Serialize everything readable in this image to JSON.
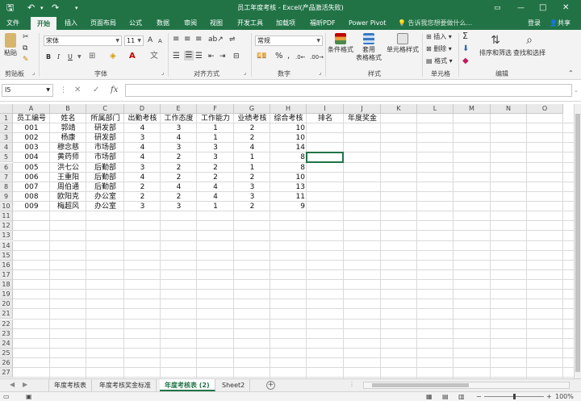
{
  "titlebar": {
    "title": "员工年度考核 - Excel(产品激活失败)",
    "save_icon": "🖫",
    "undo_icon": "↶",
    "redo_icon": "↷",
    "more_icon": "▾",
    "restore_icon": "▭",
    "minimize_icon": "—",
    "maximize_icon": "□",
    "close_icon": "✕"
  },
  "tabs": [
    "文件",
    "开始",
    "插入",
    "页面布局",
    "公式",
    "数据",
    "审阅",
    "视图",
    "开发工具",
    "加载项",
    "福昕PDF",
    "Power Pivot"
  ],
  "active_tab": "开始",
  "tellme": "告诉我您想要做什么...",
  "login": "登录",
  "share": "共享",
  "ribbon": {
    "clipboard": {
      "paste": "粘贴",
      "label": "剪贴板"
    },
    "font": {
      "name": "宋体",
      "size": "11",
      "bold": "B",
      "italic": "I",
      "underline": "U",
      "grow": "A",
      "shrink": "A",
      "label": "字体"
    },
    "alignment": {
      "label": "对齐方式"
    },
    "number": {
      "format": "常规",
      "percent": "%",
      "comma": ",",
      "label": "数字"
    },
    "styles": {
      "conditional": "条件格式",
      "table": "套用\n表格格式",
      "cell": "单元格样式",
      "label": "样式"
    },
    "cells": {
      "insert": "插入",
      "delete": "删除",
      "format": "格式",
      "label": "单元格"
    },
    "editing": {
      "sum": "Σ",
      "sort": "排序和筛选",
      "find": "查找和选择",
      "label": "编辑"
    }
  },
  "formula_bar": {
    "namebox": "I5",
    "cancel": "✕",
    "enter": "✓",
    "fx": "fx",
    "value": ""
  },
  "columns": [
    "A",
    "B",
    "C",
    "D",
    "E",
    "F",
    "G",
    "H",
    "I",
    "J",
    "K",
    "L",
    "M",
    "N",
    "O"
  ],
  "rows": [
    "1",
    "2",
    "3",
    "4",
    "5",
    "6",
    "7",
    "8",
    "9",
    "10",
    "11",
    "12",
    "13",
    "14",
    "15",
    "16",
    "17",
    "18",
    "19",
    "20",
    "21",
    "22",
    "23",
    "24",
    "25",
    "26",
    "27"
  ],
  "table": {
    "headers": [
      "员工编号",
      "姓名",
      "所属部门",
      "出勤考核",
      "工作态度",
      "工作能力",
      "业绩考核",
      "综合考核",
      "排名",
      "年度奖金"
    ],
    "rows": [
      [
        "001",
        "郭靖",
        "研发部",
        "4",
        "3",
        "1",
        "2",
        "10"
      ],
      [
        "002",
        "杨康",
        "研发部",
        "3",
        "4",
        "1",
        "2",
        "10"
      ],
      [
        "003",
        "穆念慈",
        "市场部",
        "4",
        "3",
        "3",
        "4",
        "14"
      ],
      [
        "004",
        "黄药师",
        "市场部",
        "4",
        "2",
        "3",
        "1",
        "8"
      ],
      [
        "005",
        "洪七公",
        "后勤部",
        "3",
        "2",
        "2",
        "1",
        "8"
      ],
      [
        "006",
        "王重阳",
        "后勤部",
        "4",
        "2",
        "2",
        "2",
        "10"
      ],
      [
        "007",
        "周伯通",
        "后勤部",
        "2",
        "4",
        "4",
        "3",
        "13"
      ],
      [
        "008",
        "欧阳克",
        "办公室",
        "2",
        "2",
        "4",
        "3",
        "11"
      ],
      [
        "009",
        "梅超风",
        "办公室",
        "3",
        "3",
        "1",
        "2",
        "9"
      ]
    ]
  },
  "sheets": [
    "年度考核表",
    "年度考核奖金标准",
    "年度考核表 (2)",
    "Sheet2"
  ],
  "active_sheet": "年度考核表 (2)",
  "status": {
    "zoom": "100%",
    "minus": "−",
    "plus": "+"
  }
}
